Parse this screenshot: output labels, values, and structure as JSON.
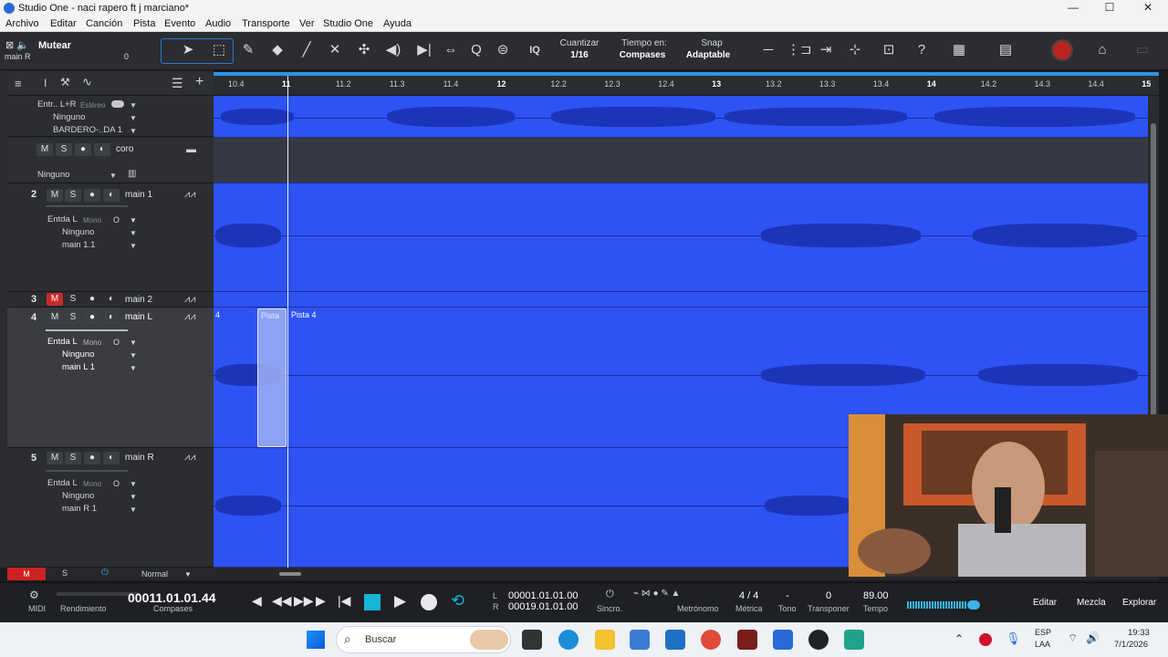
{
  "window": {
    "title": "Studio One - naci rapero ft j marciano*",
    "minimize": "—",
    "maximize": "☐",
    "close": "✕"
  },
  "menu": [
    "Archivo",
    "Editar",
    "Canción",
    "Pista",
    "Evento",
    "Audio",
    "Transporte",
    "Ver",
    "Studio One",
    "Ayuda"
  ],
  "toolbar": {
    "mute_label": "Mutear",
    "channel_label": "main R",
    "channel_value": "0",
    "quantize_label": "Cuantizar",
    "quantize_value": "1/16",
    "timebase_label": "Tiempo en:",
    "timebase_value": "Compases",
    "snap_label": "Snap",
    "snap_value": "Adaptable",
    "iq_label": "IQ"
  },
  "ruler": {
    "ticks": [
      "10.4",
      "11",
      "11.2",
      "11.3",
      "11.4",
      "12",
      "12.2",
      "12.3",
      "12.4",
      "13",
      "13.2",
      "13.3",
      "13.4",
      "14",
      "14.2",
      "14.3",
      "14.4",
      "15"
    ],
    "major": [
      "11",
      "12",
      "13",
      "14",
      "15"
    ]
  },
  "tracks": {
    "t0": {
      "input": "Entr.. L+R",
      "input_mode": "Estéreo",
      "sub2": "Ninguno",
      "sub3": "BARDERO-..DA 1"
    },
    "folder": {
      "m": "M",
      "s": "S",
      "name": "coro",
      "sub": "Ninguno"
    },
    "t2": {
      "num": "2",
      "m": "M",
      "s": "S",
      "name": "main 1",
      "input": "Entda L",
      "input_mode": "Mono",
      "sub2": "Ninguno",
      "sub3": "main 1.1"
    },
    "t3": {
      "num": "3",
      "m": "M",
      "s": "S",
      "name": "main 2"
    },
    "t4": {
      "num": "4",
      "m": "M",
      "s": "S",
      "name": "main L",
      "input": "Entda L",
      "input_mode": "Mono",
      "sub2": "Ninguno",
      "sub3": "main L 1"
    },
    "t5": {
      "num": "5",
      "m": "M",
      "s": "S",
      "name": "main R",
      "input": "Entda L",
      "input_mode": "Mono",
      "sub2": "Ninguno",
      "sub3": "main R 1"
    }
  },
  "events": {
    "left_num": "4",
    "clip": "Pista",
    "clip2": "Pista 4"
  },
  "footer": {
    "m": "M",
    "s": "S",
    "mode": "Normal"
  },
  "transport": {
    "midi": "MIDI",
    "perf": "Rendimiento",
    "position": "00011.01.01.44",
    "position_unit": "Compases",
    "loop_l": "00001.01.01.00",
    "loop_r": "00019.01.01.00",
    "l": "L",
    "r": "R",
    "sync": "Sincro.",
    "metronome": "Metrónomo",
    "signature": "4 / 4",
    "signature_label": "Métrica",
    "key": "-",
    "key_label": "Tono",
    "transpose": "0",
    "transpose_label": "Transponer",
    "tempo": "89.00",
    "tempo_label": "Tempo",
    "edit": "Editar",
    "mix": "Mezcla",
    "browse": "Explorar"
  },
  "taskbar": {
    "search": "Buscar",
    "lang1": "ESP",
    "lang2": "LAA",
    "time": "19:33",
    "date": "7/1/2026"
  },
  "colors": {
    "lane": "#2e53f4",
    "wave": "#1c35b8",
    "accent": "#2f73d6",
    "record": "#c62a2a"
  }
}
